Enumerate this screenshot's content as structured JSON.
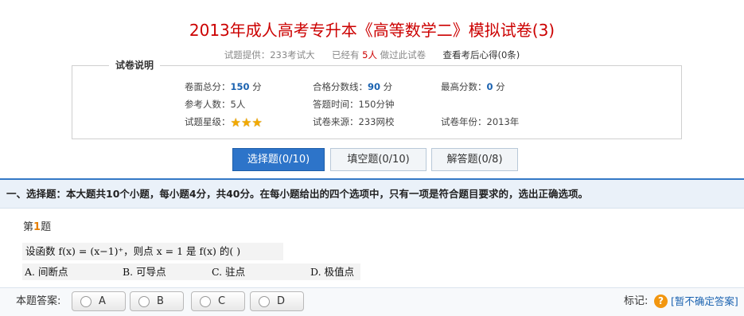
{
  "header": {
    "title": "2013年成人高考专升本《高等数学二》模拟试卷(3)",
    "provider_label": "试题提供：",
    "provider": "233考试大",
    "taken_prefix": "已经有",
    "taken_count": "5人",
    "taken_suffix": "做过此试卷",
    "view_notes_link": "查看考后心得(0条)"
  },
  "info": {
    "legend": "试卷说明",
    "total_label": "卷面总分：",
    "total_value": "150",
    "total_unit": "分",
    "pass_label": "合格分数线：",
    "pass_value": "90",
    "pass_unit": "分",
    "max_label": "最高分数：",
    "max_value": "0",
    "max_unit": "分",
    "participants_label": "参考人数：",
    "participants_value": "5人",
    "time_label": "答题时间：",
    "time_value": "150分钟",
    "stars_label": "试题星级：",
    "stars": 3,
    "source_label": "试卷来源：",
    "source_value": "233网校",
    "year_label": "试卷年份：",
    "year_value": "2013年"
  },
  "tabs": [
    {
      "label": "选择题(0/10)",
      "active": true
    },
    {
      "label": "填空题(0/10)",
      "active": false
    },
    {
      "label": "解答题(0/8)",
      "active": false
    }
  ],
  "section": {
    "instruction": "一、选择题：本大题共10个小题，每小题4分，共40分。在每小题给出的四个选项中，只有一项是符合题目要求的，选出正确选项。"
  },
  "question": {
    "number_prefix": "第",
    "number": "1",
    "number_suffix": "题",
    "stem": "设函数 f(x) = (x−1)⁺，则点 x = 1 是 f(x) 的(     )",
    "options": [
      "A. 间断点",
      "B. 可导点",
      "C. 驻点",
      "D. 极值点"
    ]
  },
  "answer": {
    "label": "本题答案:",
    "choices": [
      "A",
      "B",
      "C",
      "D"
    ],
    "mark_label": "标记:",
    "mark_link": "[暂不确定答案]"
  },
  "colors": {
    "title": "#cc0000",
    "accent": "#2d74c9",
    "link": "#1a62b0",
    "star": "#f2a900"
  }
}
